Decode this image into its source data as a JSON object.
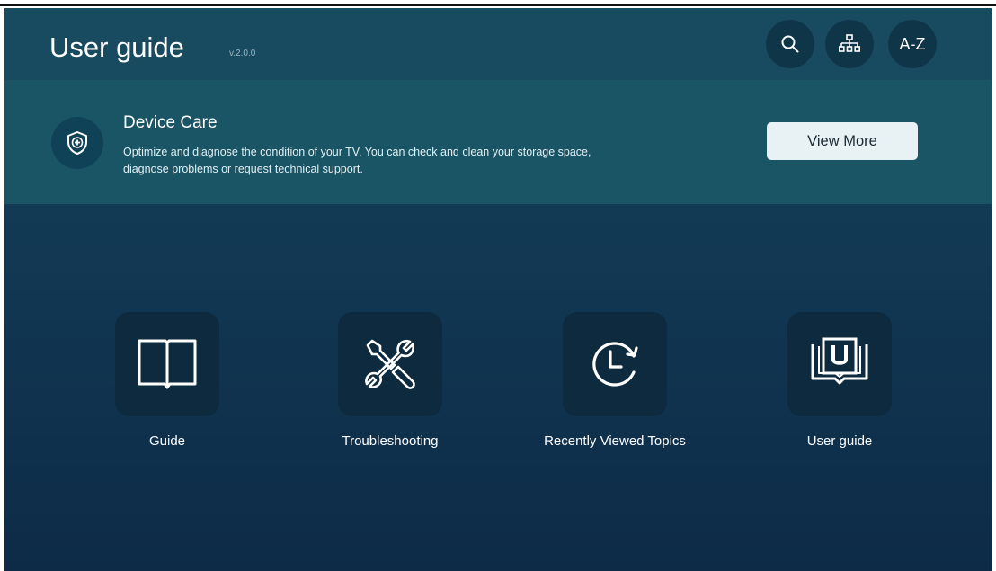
{
  "header": {
    "title": "User guide",
    "version": "v.2.0.0",
    "buttons": [
      {
        "icon": "search-icon"
      },
      {
        "icon": "sitemap-icon"
      },
      {
        "label": "A-Z"
      }
    ]
  },
  "banner": {
    "icon": "shield-plus-icon",
    "title": "Device Care",
    "description": "Optimize and diagnose the condition of your TV. You can check and clean your storage space, diagnose problems or request technical support.",
    "button_label": "View More"
  },
  "tiles": [
    {
      "label": "Guide",
      "icon": "book-icon"
    },
    {
      "label": "Troubleshooting",
      "icon": "tools-icon"
    },
    {
      "label": "Recently Viewed Topics",
      "icon": "history-icon"
    },
    {
      "label": "User guide",
      "icon": "user-guide-book-icon"
    }
  ],
  "colors": {
    "header_bg": "#194b60",
    "banner_bg": "#1a5566",
    "background": "#0d2b47",
    "tile_bg": "#0e2a3e",
    "button_bg": "#e8f1f3"
  }
}
